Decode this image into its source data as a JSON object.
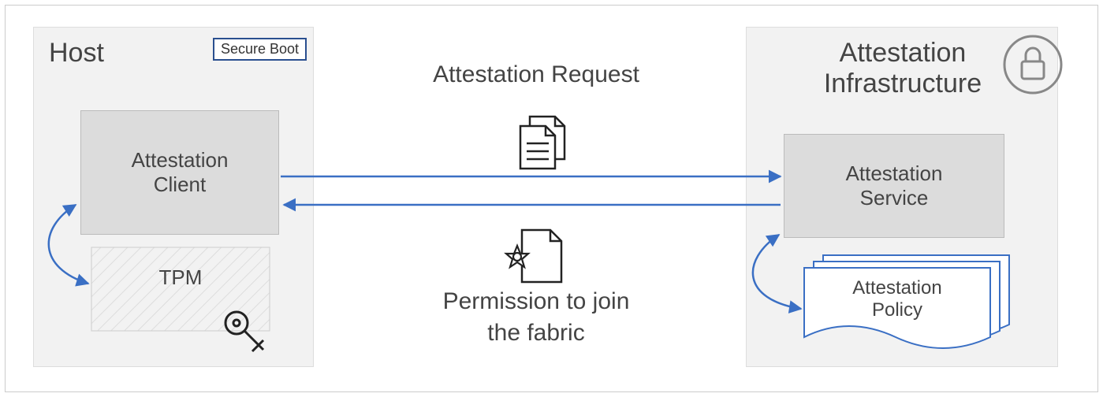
{
  "host": {
    "title": "Host",
    "secure_boot": "Secure Boot",
    "client_line1": "Attestation",
    "client_line2": "Client",
    "tpm": "TPM"
  },
  "center": {
    "request": "Attestation Request",
    "permission_line1": "Permission to join",
    "permission_line2": "the fabric"
  },
  "ai": {
    "title_line1": "Attestation",
    "title_line2": "Infrastructure",
    "service_line1": "Attestation",
    "service_line2": "Service",
    "policy_line1": "Attestation",
    "policy_line2": "Policy"
  },
  "icons": {
    "lock": "lock-icon",
    "key": "key-icon",
    "docs": "documents-icon",
    "cert": "certificate-icon"
  },
  "colors": {
    "blue": "#3a6fc4",
    "panel_bg": "#f2f2f2",
    "box_bg": "#dcdcdc"
  }
}
